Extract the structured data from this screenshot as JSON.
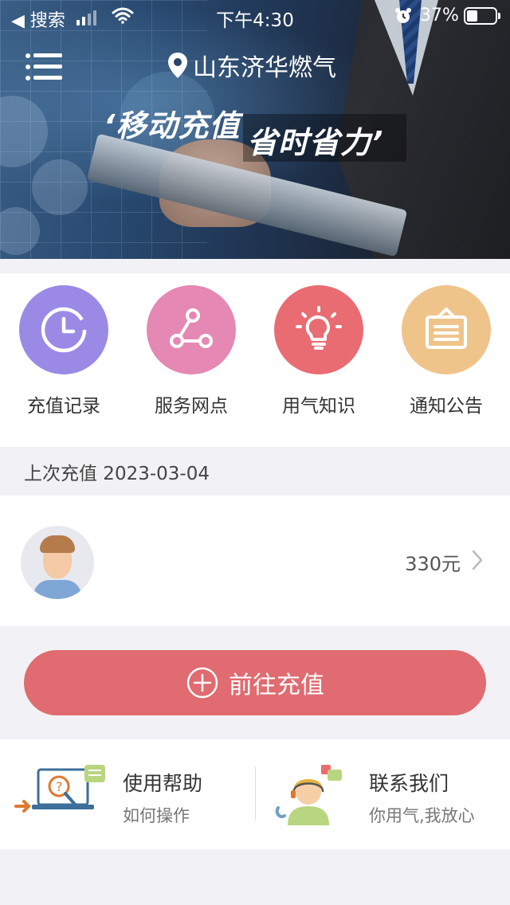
{
  "status_bar": {
    "back_label": "◀ 搜索",
    "time": "下午4:30",
    "battery_pct": "37%",
    "battery_level": 0.37
  },
  "header": {
    "location": "山东济华燃气",
    "slogan_1": "‘移动充值",
    "slogan_2": "省时省力’"
  },
  "quick_actions": [
    {
      "label": "充值记录",
      "icon": "clock-icon",
      "color": "#9a8ae6"
    },
    {
      "label": "服务网点",
      "icon": "share-nodes-icon",
      "color": "#e588b3"
    },
    {
      "label": "用气知识",
      "icon": "lightbulb-icon",
      "color": "#e96c72"
    },
    {
      "label": "通知公告",
      "icon": "notice-board-icon",
      "color": "#efc48b"
    }
  ],
  "last_recharge": "上次充值 2023-03-04",
  "account": {
    "amount": "330元"
  },
  "charge_button": "前往充值",
  "cards": {
    "help": {
      "title": "使用帮助",
      "subtitle": "如何操作"
    },
    "contact": {
      "title": "联系我们",
      "subtitle": "你用气,我放心"
    }
  },
  "colors": {
    "accent": "#e06b70",
    "background": "#f2f2f6"
  }
}
